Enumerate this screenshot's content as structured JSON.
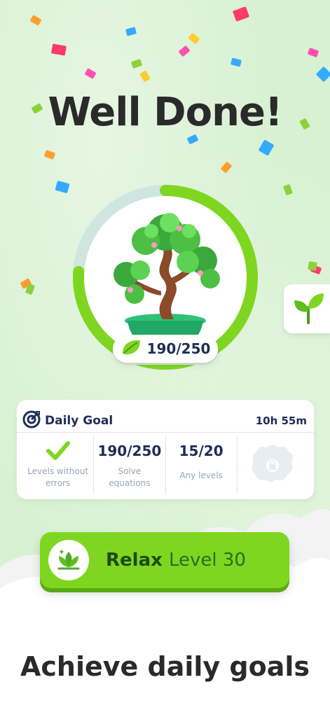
{
  "headline": "Well Done!",
  "tree_progress": {
    "value_text": "190/250",
    "fraction": 0.76,
    "leaf_icon": "leaf-icon"
  },
  "side_tab": {
    "icon": "sprout-icon"
  },
  "daily_goal": {
    "icon": "target-icon",
    "title": "Daily Goal",
    "time_left": "10h 55m",
    "goals": [
      {
        "icon": "checkmark-icon",
        "value": "",
        "label_line1": "Levels without",
        "label_line2": "errors",
        "status": "completed"
      },
      {
        "value": "190/250",
        "label_line1": "Solve",
        "label_line2": "equations",
        "status": "in-progress"
      },
      {
        "value": "15/20",
        "label_line1": "Any levels",
        "label_line2": "",
        "status": "in-progress"
      },
      {
        "icon": "locked-reward-icon",
        "value": "",
        "label_line1": "",
        "label_line2": "",
        "status": "locked"
      }
    ]
  },
  "cta": {
    "icon": "lotus-icon",
    "mode": "Relax",
    "level": "Level 30"
  },
  "caption": "Achieve daily goals",
  "colors": {
    "background": "#d8f1d2",
    "accent_green": "#7fd621",
    "progress_track": "#cfe6e0",
    "text_navy": "#1f2d57"
  }
}
